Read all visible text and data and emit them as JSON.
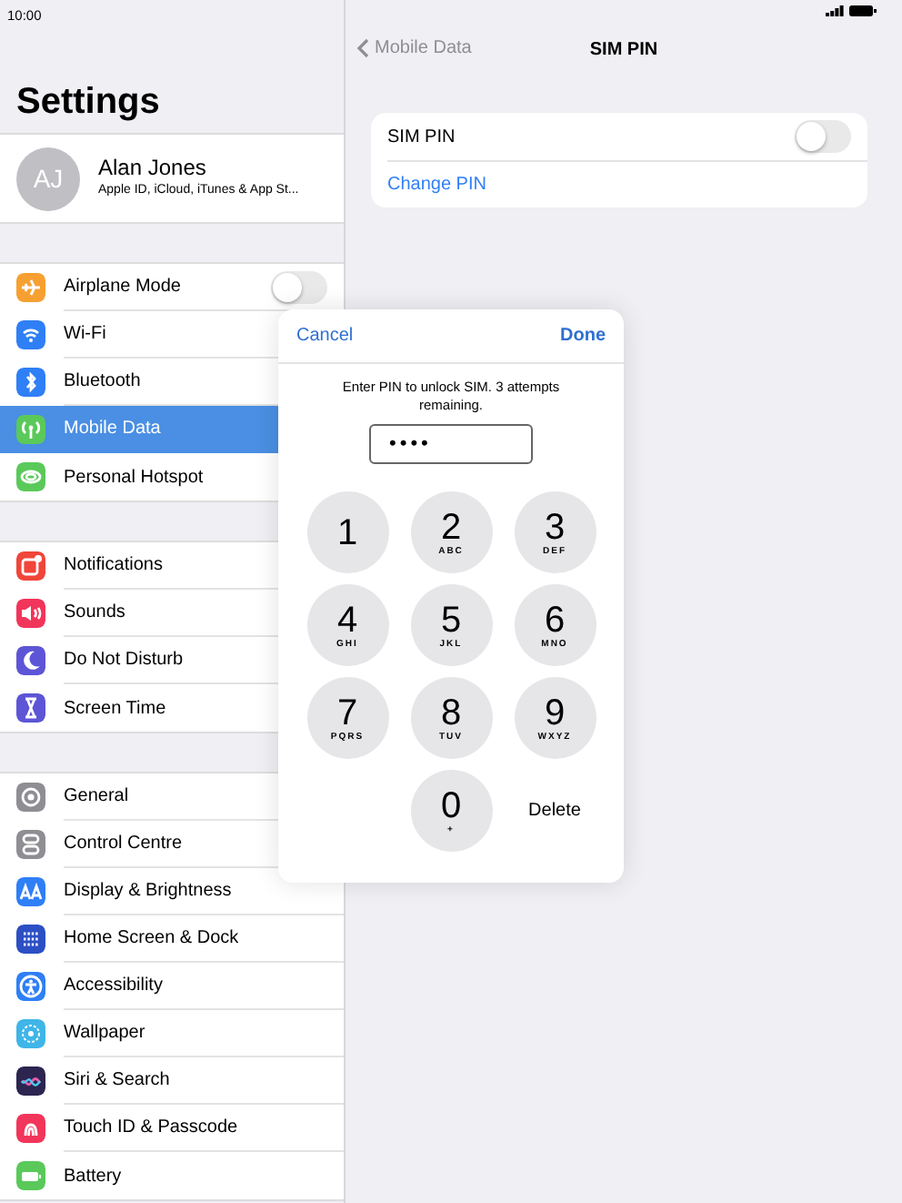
{
  "status_bar": {
    "time": "10:00"
  },
  "sidebar": {
    "title": "Settings",
    "profile": {
      "initials": "AJ",
      "name": "Alan Jones",
      "subtitle": "Apple ID, iCloud, iTunes & App St..."
    },
    "groups": [
      [
        {
          "label": "Airplane Mode",
          "color": "#f7a032",
          "kind": "toggle",
          "on": false,
          "selected": false
        },
        {
          "label": "Wi-Fi",
          "color": "#2f7ff6",
          "kind": "link",
          "selected": false
        },
        {
          "label": "Bluetooth",
          "color": "#2f7ff6",
          "kind": "link",
          "selected": false
        },
        {
          "label": "Mobile Data",
          "color": "#5ac95a",
          "kind": "link",
          "selected": true
        },
        {
          "label": "Personal Hotspot",
          "color": "#5ac95a",
          "kind": "link",
          "selected": false
        }
      ],
      [
        {
          "label": "Notifications",
          "color": "#f0453a",
          "kind": "link",
          "selected": false
        },
        {
          "label": "Sounds",
          "color": "#f2355a",
          "kind": "link",
          "selected": false
        },
        {
          "label": "Do Not Disturb",
          "color": "#5d55d6",
          "kind": "link",
          "selected": false
        },
        {
          "label": "Screen Time",
          "color": "#5d55d6",
          "kind": "link",
          "selected": false
        }
      ],
      [
        {
          "label": "General",
          "color": "#8e8e93",
          "kind": "link",
          "selected": false
        },
        {
          "label": "Control Centre",
          "color": "#8e8e93",
          "kind": "link",
          "selected": false
        },
        {
          "label": "Display & Brightness",
          "color": "#2f7ff6",
          "kind": "link",
          "selected": false
        },
        {
          "label": "Home Screen & Dock",
          "color": "#2c4fc4",
          "kind": "link",
          "selected": false
        },
        {
          "label": "Accessibility",
          "color": "#2f7ff6",
          "kind": "link",
          "selected": false
        },
        {
          "label": "Wallpaper",
          "color": "#40b5e8",
          "kind": "link",
          "selected": false
        },
        {
          "label": "Siri & Search",
          "color": "#2b2550",
          "kind": "link",
          "selected": false
        },
        {
          "label": "Touch ID & Passcode",
          "color": "#f2355a",
          "kind": "link",
          "selected": false
        },
        {
          "label": "Battery",
          "color": "#5ac95a",
          "kind": "link",
          "selected": false
        }
      ]
    ]
  },
  "detail": {
    "back": "Mobile Data",
    "title": "SIM PIN",
    "rows": [
      {
        "kind": "toggle",
        "label": "SIM PIN",
        "on": false
      },
      {
        "kind": "link",
        "label": "Change PIN"
      }
    ]
  },
  "dialog": {
    "cancel": "Cancel",
    "done": "Done",
    "message": "Enter PIN to unlock SIM. 3 attempts remaining.",
    "pin": "••••",
    "keys": [
      {
        "digit": "1"
      },
      {
        "digit": "2",
        "letters": "ABC"
      },
      {
        "digit": "3",
        "letters": "DEF"
      },
      {
        "digit": "4",
        "letters": "GHI"
      },
      {
        "digit": "5",
        "letters": "JKL"
      },
      {
        "digit": "6",
        "letters": "MNO"
      },
      {
        "digit": "7",
        "letters": "PQRS"
      },
      {
        "digit": "8",
        "letters": "TUV"
      },
      {
        "digit": "9",
        "letters": "WXYZ"
      },
      {
        "digit": "0",
        "letters": "+"
      }
    ],
    "delete": "Delete"
  }
}
